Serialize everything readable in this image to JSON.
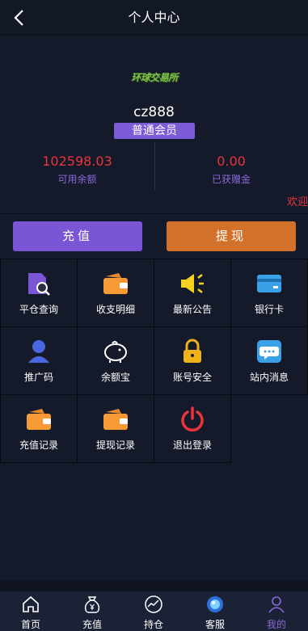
{
  "header": {
    "title": "个人中心",
    "back_icon": "chevron-left-icon"
  },
  "profile": {
    "logo_text": "环球交易所",
    "username": "cz888",
    "level": "普通会员",
    "balance_value": "102598.03",
    "balance_label": "可用余额",
    "bonus_value": "0.00",
    "bonus_label": "已获赠金",
    "marquee": "欢迎"
  },
  "actions": {
    "recharge": "充值",
    "withdraw": "提现"
  },
  "grid": [
    {
      "label": "平仓查询",
      "icon": "close-position-query-icon"
    },
    {
      "label": "收支明细",
      "icon": "wallet-icon"
    },
    {
      "label": "最新公告",
      "icon": "announcement-speaker-icon"
    },
    {
      "label": "银行卡",
      "icon": "bank-card-icon"
    },
    {
      "label": "推广码",
      "icon": "person-icon"
    },
    {
      "label": "余额宝",
      "icon": "piggy-bank-icon"
    },
    {
      "label": "账号安全",
      "icon": "lock-icon"
    },
    {
      "label": "站内消息",
      "icon": "chat-message-icon"
    },
    {
      "label": "充值记录",
      "icon": "wallet-icon"
    },
    {
      "label": "提现记录",
      "icon": "wallet-icon"
    },
    {
      "label": "退出登录",
      "icon": "power-icon"
    }
  ],
  "tabs": [
    {
      "label": "首页",
      "icon": "home-icon"
    },
    {
      "label": "充值",
      "icon": "money-bag-icon"
    },
    {
      "label": "持仓",
      "icon": "chart-line-icon"
    },
    {
      "label": "客服",
      "icon": "customer-service-icon"
    },
    {
      "label": "我的",
      "icon": "user-icon"
    }
  ],
  "colors": {
    "background": "#151a2b",
    "accent_purple": "#7a55d6",
    "accent_orange": "#d2722a",
    "value_red": "#e8363c"
  }
}
